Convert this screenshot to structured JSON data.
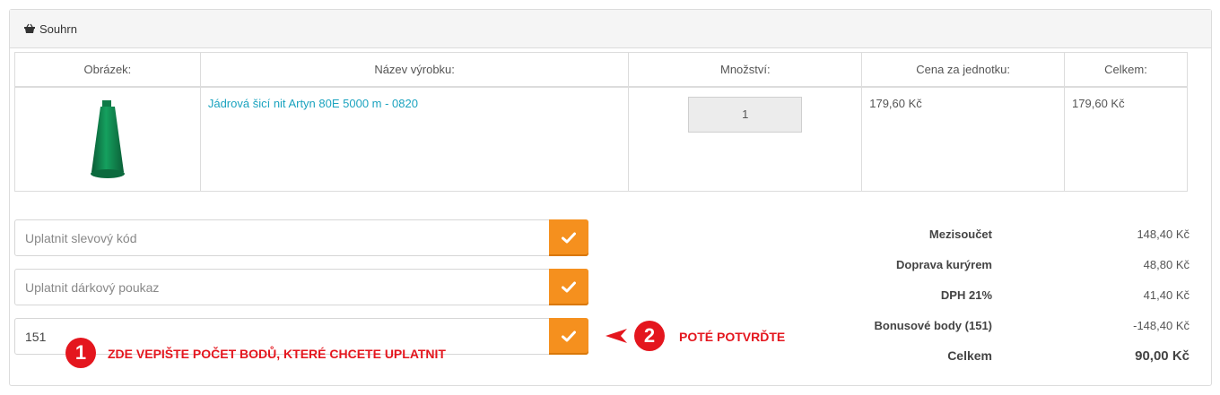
{
  "panel": {
    "title": "Souhrn",
    "icon": "basket-icon"
  },
  "table": {
    "headers": [
      "Obrázek:",
      "Název výrobku:",
      "Množství:",
      "Cena za jednotku:",
      "Celkem:"
    ],
    "rows": [
      {
        "image": "green-thread-cone",
        "name": "Jádrová šicí nit Artyn 80E 5000 m - 0820",
        "qty": "1",
        "unit_price": "179,60 Kč",
        "total": "179,60 Kč"
      }
    ]
  },
  "inputs": {
    "discount_placeholder": "Uplatnit slevový kód",
    "voucher_placeholder": "Uplatnit dárkový poukaz",
    "points_value": "151"
  },
  "summary": {
    "subtotal_label": "Mezisoučet",
    "subtotal": "148,40 Kč",
    "shipping_label": "Doprava kurýrem",
    "shipping": "48,80 Kč",
    "vat_label": "DPH 21%",
    "vat": "41,40 Kč",
    "bonus_label": "Bonusové body (151)",
    "bonus": "-148,40 Kč",
    "total_label": "Celkem",
    "total": "90,00 Kč"
  },
  "annotations": {
    "step1_number": "1",
    "step1_text": "ZDE VEPIŠTE POČET BODŮ, KTERÉ CHCETE UPLATNIT",
    "step2_number": "2",
    "step2_text": "POTÉ POTVRĎTE"
  },
  "colors": {
    "accent": "#f5901e",
    "link": "#1ba3bf",
    "annotation": "#e4161e"
  }
}
